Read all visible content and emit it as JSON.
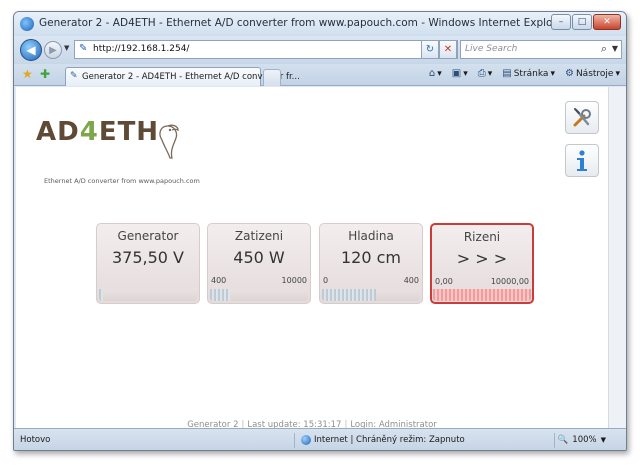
{
  "window": {
    "title": "Generator 2 - AD4ETH - Ethernet A/D converter from www.papouch.com - Windows Internet Explorer",
    "buttons": {
      "minimize": "–",
      "maximize": "□",
      "close": "✕"
    }
  },
  "addressbar": {
    "url": "http://192.168.1.254/",
    "search_placeholder": "Live Search"
  },
  "tabbar": {
    "active_tab": "Generator 2 - AD4ETH - Ethernet A/D converter fr...",
    "tools": [
      {
        "label": ""
      },
      {
        "label": ""
      },
      {
        "label": ""
      },
      {
        "label": "Stránka"
      },
      {
        "label": "Nástroje"
      }
    ]
  },
  "logo": {
    "text_a": "AD",
    "text_4": "4",
    "text_b": "ETH",
    "tagline": "Ethernet A/D converter from www.papouch.com"
  },
  "tiles": [
    {
      "name": "Generator",
      "value": "375,50 V",
      "min": "",
      "max": "",
      "level": 0.04
    },
    {
      "name": "Zatizeni",
      "value": "450 W",
      "min": "400",
      "max": "10000",
      "level": 0.2
    },
    {
      "name": "Hladina",
      "value": "120 cm",
      "min": "0",
      "max": "400",
      "level": 0.55
    },
    {
      "name": "Rizeni",
      "value": "> > >",
      "min": "0,00",
      "max": "10000,00",
      "level": 1.0
    }
  ],
  "footer": {
    "device": "Generator 2",
    "last_update": "Last update: 15:31:17",
    "login": "Login: Administrator"
  },
  "statusbar": {
    "left": "Hotovo",
    "zone": "Internet | Chráněný režim: Zapnuto",
    "zoom": "100%"
  },
  "colors": {
    "alarm_border": "#cc3b3b",
    "logo_brown": "#5f4a36",
    "logo_green": "#7ea64a"
  },
  "icons": {
    "settings": "tools-icon",
    "info": "info-icon"
  }
}
